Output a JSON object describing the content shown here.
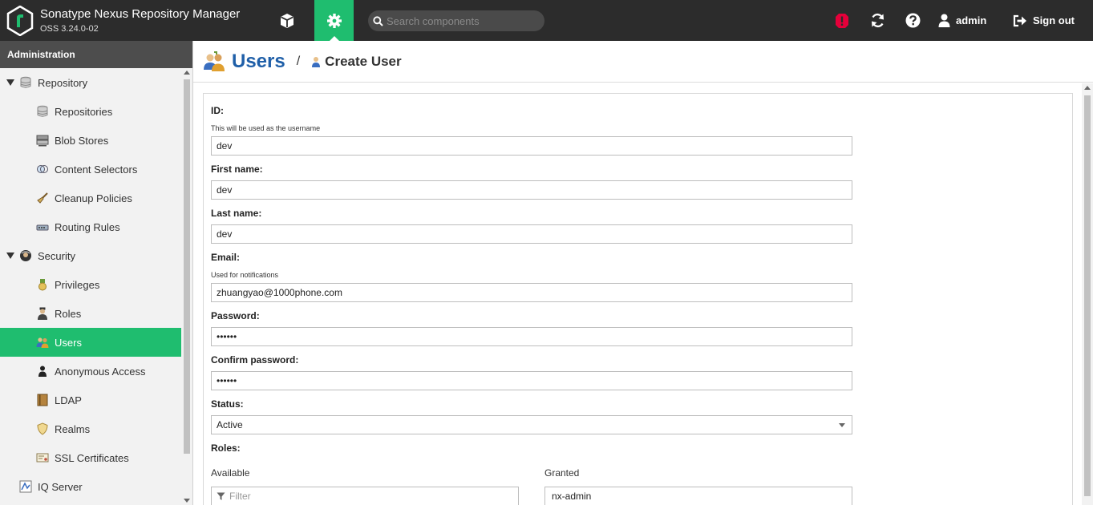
{
  "header": {
    "title": "Sonatype Nexus Repository Manager",
    "version": "OSS 3.24.0-02",
    "search_placeholder": "Search components",
    "user": "admin",
    "signout": "Sign out",
    "accent": "#1fbd6f",
    "alert_color": "#e5003a"
  },
  "sidebar": {
    "heading": "Administration",
    "items": [
      {
        "label": "Repository",
        "icon": "database-icon",
        "kind": "group"
      },
      {
        "label": "Repositories",
        "icon": "database-icon",
        "kind": "child"
      },
      {
        "label": "Blob Stores",
        "icon": "server-icon",
        "kind": "child"
      },
      {
        "label": "Content Selectors",
        "icon": "selector-icon",
        "kind": "child"
      },
      {
        "label": "Cleanup Policies",
        "icon": "broom-icon",
        "kind": "child"
      },
      {
        "label": "Routing Rules",
        "icon": "router-icon",
        "kind": "child"
      },
      {
        "label": "Security",
        "icon": "security-icon",
        "kind": "group"
      },
      {
        "label": "Privileges",
        "icon": "medal-icon",
        "kind": "child"
      },
      {
        "label": "Roles",
        "icon": "role-icon",
        "kind": "child"
      },
      {
        "label": "Users",
        "icon": "users-icon",
        "kind": "child",
        "active": true
      },
      {
        "label": "Anonymous Access",
        "icon": "person-icon",
        "kind": "child"
      },
      {
        "label": "LDAP",
        "icon": "book-icon",
        "kind": "child"
      },
      {
        "label": "Realms",
        "icon": "shield-icon",
        "kind": "child"
      },
      {
        "label": "SSL Certificates",
        "icon": "certificate-icon",
        "kind": "child"
      },
      {
        "label": "IQ Server",
        "icon": "iq-icon",
        "kind": "top"
      }
    ]
  },
  "page": {
    "title": "Users",
    "breadcrumb_sep": "/",
    "breadcrumb": "Create User"
  },
  "form": {
    "id_label": "ID:",
    "id_hint": "This will be used as the username",
    "id_value": "dev",
    "first_label": "First name:",
    "first_value": "dev",
    "last_label": "Last name:",
    "last_value": "dev",
    "email_label": "Email:",
    "email_hint": "Used for notifications",
    "email_value": "zhuangyao@1000phone.com",
    "password_label": "Password:",
    "password_value": "••••••",
    "confirm_label": "Confirm password:",
    "confirm_value": "••••••",
    "status_label": "Status:",
    "status_value": "Active",
    "roles_label": "Roles:",
    "available_label": "Available",
    "granted_label": "Granted",
    "filter_placeholder": "Filter",
    "granted_item": "nx-admin"
  }
}
